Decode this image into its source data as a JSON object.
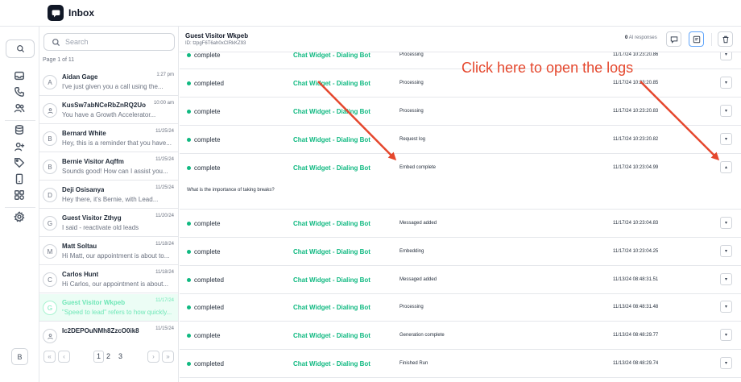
{
  "app": {
    "title": "Inbox"
  },
  "rail": {
    "avatar_initial": "B",
    "icons": [
      "search-icon",
      "inbox-icon",
      "phone-icon",
      "contacts-icon",
      "database-icon",
      "add-user-icon",
      "tag-icon",
      "mobile-icon",
      "integrations-icon",
      "settings-icon"
    ]
  },
  "list": {
    "search_placeholder": "Search",
    "page_info": "Page 1 of 11",
    "conversations": [
      {
        "initial": "A",
        "name": "Aidan Gage",
        "time": "1:27 pm",
        "snippet": "I've just given you a call using the..."
      },
      {
        "initial": "",
        "name": "KusSw7abNCeRbZnRQ2Uo",
        "time": "10:00 am",
        "snippet": "You have a Growth Accelerator..."
      },
      {
        "initial": "B",
        "name": "Bernard White",
        "time": "11/25/24",
        "snippet": "Hey, this is a reminder that you have..."
      },
      {
        "initial": "B",
        "name": "Bernie Visitor Aqffm",
        "time": "11/25/24",
        "snippet": "Sounds good! How can I assist you..."
      },
      {
        "initial": "D",
        "name": "Deji Osisanya",
        "time": "11/25/24",
        "snippet": "Hey there, it's Bernie, with Lead..."
      },
      {
        "initial": "G",
        "name": "Guest Visitor Zthyg",
        "time": "11/20/24",
        "snippet": "I said - reactivate old leads"
      },
      {
        "initial": "M",
        "name": "Matt Soltau",
        "time": "11/18/24",
        "snippet": "Hi Matt, our appointment is about to..."
      },
      {
        "initial": "C",
        "name": "Carlos Hunt",
        "time": "11/18/24",
        "snippet": "Hi Carlos, our appointment is about..."
      },
      {
        "initial": "G",
        "name": "Guest Visitor Wkpeb",
        "time": "11/17/24",
        "snippet": "\"Speed to lead\" refers to how quickly..."
      },
      {
        "initial": "",
        "name": "Ic2DEPOuNMh8ZzcO0ik8",
        "time": "11/15/24",
        "snippet": ""
      }
    ],
    "pager": {
      "pages": [
        "1",
        "2",
        "3"
      ],
      "first": "«",
      "prev": "‹",
      "next": "›",
      "last": "»"
    }
  },
  "conversation": {
    "title": "Guest Visitor Wkpeb",
    "id": "ID: tzpgF6T6ah0xCIRkKZ93",
    "ai_responses_count": "0",
    "ai_responses_label": "AI responses"
  },
  "logs": [
    {
      "status": "complete",
      "source": "Chat Widget - Dialing Bot",
      "event": "Processing",
      "time": "11/17/24 10:23:20.86",
      "toggle": "▾"
    },
    {
      "status": "completed",
      "source": "Chat Widget - Dialing Bot",
      "event": "Processing",
      "time": "11/17/24 10:23:20.85",
      "toggle": "▾"
    },
    {
      "status": "complete",
      "source": "Chat Widget - Dialing Bot",
      "event": "Processing",
      "time": "11/17/24 10:23:20.83",
      "toggle": "▾"
    },
    {
      "status": "complete",
      "source": "Chat Widget - Dialing Bot",
      "event": "Request log",
      "time": "11/17/24 10:23:20.82",
      "toggle": "▾"
    },
    {
      "status": "complete",
      "source": "Chat Widget - Dialing Bot",
      "event": "Embed complete",
      "time": "11/17/24 10:23:04.99",
      "toggle": "▴",
      "detail": "What is the importance of taking breaks?"
    },
    {
      "status": "complete",
      "source": "Chat Widget - Dialing Bot",
      "event": "Messaged added",
      "time": "11/17/24 10:23:04.83",
      "toggle": "▾"
    },
    {
      "status": "complete",
      "source": "Chat Widget - Dialing Bot",
      "event": "Embedding",
      "time": "11/17/24 10:23:04.25",
      "toggle": "▾"
    },
    {
      "status": "completed",
      "source": "Chat Widget - Dialing Bot",
      "event": "Messaged added",
      "time": "11/13/24 08:48:31.51",
      "toggle": "▾"
    },
    {
      "status": "completed",
      "source": "Chat Widget - Dialing Bot",
      "event": "Processing",
      "time": "11/13/24 08:48:31.48",
      "toggle": "▾"
    },
    {
      "status": "complete",
      "source": "Chat Widget - Dialing Bot",
      "event": "Generation complete",
      "time": "11/13/24 08:48:29.77",
      "toggle": "▾"
    },
    {
      "status": "completed",
      "source": "Chat Widget - Dialing Bot",
      "event": "Finished Run",
      "time": "11/13/24 08:48:29.74",
      "toggle": "▾"
    }
  ],
  "annotation": {
    "text": "Click here to open the logs",
    "color": "#e5472d"
  },
  "colors": {
    "accent": "#10b981",
    "active_row": "#ecfdf5"
  }
}
